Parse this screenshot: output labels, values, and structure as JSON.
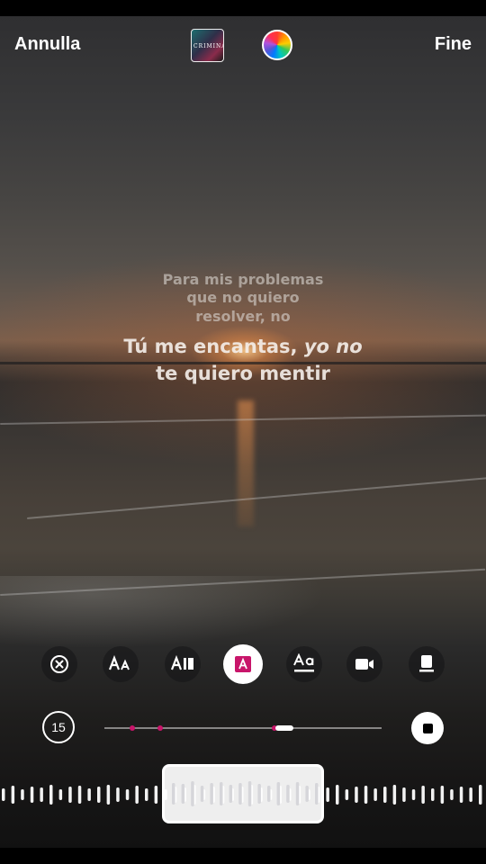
{
  "header": {
    "cancel_label": "Annulla",
    "done_label": "Fine",
    "album_thumb_text": "CRIMINAL"
  },
  "lyrics": {
    "previous_lines": [
      "Para mis problemas",
      "que no quiero",
      "resolver, no"
    ],
    "current_line_1_a": "Tú me encantas, ",
    "current_line_1_b": "yo no",
    "current_line_2": "te quiero mentir"
  },
  "toolbar": {
    "items": [
      {
        "name": "close-icon"
      },
      {
        "name": "text-size-icon",
        "label": "AA"
      },
      {
        "name": "text-style-icon",
        "label": "A"
      },
      {
        "name": "text-highlight-icon",
        "label": "A",
        "active": true
      },
      {
        "name": "text-underline-icon",
        "label": "Aa"
      },
      {
        "name": "video-icon"
      },
      {
        "name": "sticker-card-icon"
      }
    ],
    "accent_color": "#c8156a"
  },
  "timeline": {
    "duration_label": "15"
  },
  "colors": {
    "text_primary": "#ffffff",
    "highlight": "#c8156a"
  }
}
